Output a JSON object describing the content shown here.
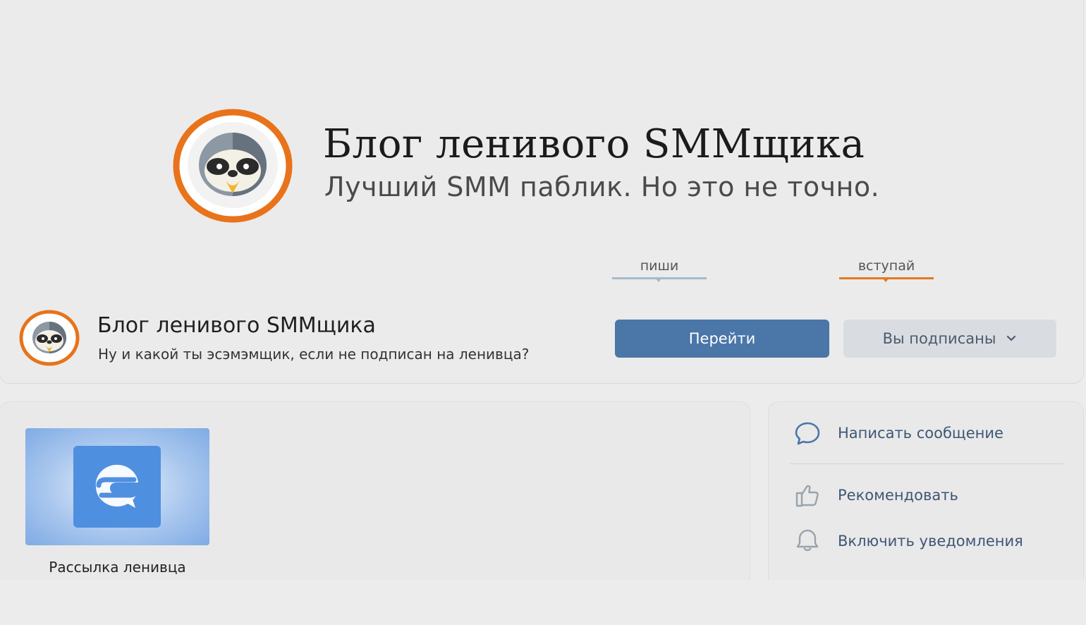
{
  "cover": {
    "title": "Блог ленивого SMMщика",
    "subtitle": "Лучший SMM паблик. Но это не точно.",
    "links": [
      {
        "label": "пиши",
        "color": "#a4b9cc"
      },
      {
        "label": "вступай",
        "color": "#e37a1e"
      }
    ]
  },
  "community": {
    "name": "Блог ленивого SMMщика",
    "status": "Ну и какой ты эсэмэмщик, если не подписан на ленивца?",
    "primary_button": "Перейти",
    "subscribed_button": "Вы подписаны"
  },
  "apps": [
    {
      "label": "Рассылка ленивца",
      "icon": "chat-bubbles-icon"
    }
  ],
  "actions": [
    {
      "label": "Написать сообщение",
      "icon": "message-icon"
    },
    {
      "label": "Рекомендовать",
      "icon": "thumbs-up-icon"
    },
    {
      "label": "Включить уведомления",
      "icon": "bell-icon"
    }
  ],
  "colors": {
    "accent": "#4a76a8",
    "brand_orange": "#e37a1e",
    "link_text": "#3e5775"
  }
}
